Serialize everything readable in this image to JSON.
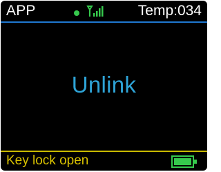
{
  "status": {
    "app_label": "APP",
    "temp_label": "Temp:034"
  },
  "main": {
    "message": "Unlink"
  },
  "footer": {
    "status_text": "Key lock open"
  },
  "icons": {
    "connection": "status-dot-icon",
    "signal": "signal-antenna-icon",
    "battery": "battery-full-icon"
  },
  "colors": {
    "screen_bg": "#000000",
    "text_primary": "#ffffff",
    "accent_blue": "#2ea3d6",
    "accent_green": "#36c94d",
    "footer_text": "#d8c100",
    "divider_top": "#1f78d1",
    "divider_bottom": "#c9ba00"
  }
}
